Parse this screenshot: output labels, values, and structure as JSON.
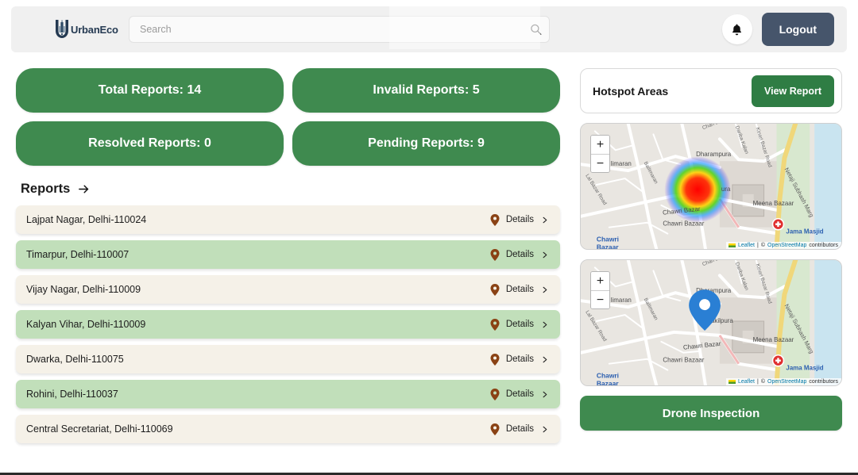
{
  "header": {
    "brand_name": "UrbanEco",
    "logo_icon": "u-building-logo-icon",
    "search": {
      "placeholder": "Search",
      "value": "",
      "icon": "search-icon"
    },
    "notification_icon": "bell-icon",
    "logout_label": "Logout"
  },
  "stats": [
    {
      "label": "Total Reports: 14",
      "name": "total-reports"
    },
    {
      "label": "Invalid Reports: 5",
      "name": "invalid-reports"
    },
    {
      "label": "Resolved Reports: 0",
      "name": "resolved-reports"
    },
    {
      "label": "Pending Reports: 9",
      "name": "pending-reports"
    }
  ],
  "reports_section": {
    "title": "Reports",
    "arrow_icon": "arrow-right-icon",
    "details_label": "Details",
    "pin_icon": "map-pin-icon",
    "chevron_icon": "chevron-right-icon",
    "rows": [
      {
        "location": "Lajpat Nagar, Delhi-110024",
        "tone": "cream"
      },
      {
        "location": "Timarpur, Delhi-110007",
        "tone": "green"
      },
      {
        "location": "Vijay Nagar, Delhi-110009",
        "tone": "cream"
      },
      {
        "location": "Kalyan Vihar, Delhi-110009",
        "tone": "green"
      },
      {
        "location": "Dwarka, Delhi-110075",
        "tone": "cream"
      },
      {
        "location": "Rohini, Delhi-110037",
        "tone": "green"
      },
      {
        "location": "Central Secretariat, Delhi-110069",
        "tone": "cream"
      }
    ]
  },
  "hotspot": {
    "title": "Hotspot Areas",
    "view_report_label": "View Report"
  },
  "maps": [
    {
      "name": "heatmap-map",
      "zoom_in_label": "+",
      "zoom_out_label": "−",
      "marker_type": "heatmap",
      "attribution": {
        "leaflet_label": "Leaflet",
        "separator": " | ",
        "osm_prefix": "© ",
        "osm_label": "OpenStreetMap",
        "osm_suffix": " contributors"
      },
      "labels": [
        "Dharampura",
        "Meena Bazaar",
        "Chawri Bazar",
        "Chawri Bazaar",
        "Jama Masjid",
        "Netaji Subhash Marg",
        "Ballimaran",
        "Lal Bazar Road",
        "limaran",
        "Chawri",
        "Bazaar",
        "ura"
      ]
    },
    {
      "name": "marker-map",
      "zoom_in_label": "+",
      "zoom_out_label": "−",
      "marker_type": "pin",
      "attribution": {
        "leaflet_label": "Leaflet",
        "separator": " | ",
        "osm_prefix": "© ",
        "osm_label": "OpenStreetMap",
        "osm_suffix": " contributors"
      },
      "labels": [
        "Dharampura",
        "Meena Bazaar",
        "Chawri Bazar",
        "Chawri Bazaar",
        "Jama Masjid",
        "Netaji Subhash Marg",
        "Ballimaran",
        "Lal Bazar Road",
        "limaran",
        "Chawri",
        "Bazaar",
        "akilpura"
      ]
    }
  ],
  "drone_button_label": "Drone Inspection",
  "colors": {
    "brand_green": "#3f8a4f",
    "dark_green": "#2f7d44",
    "row_cream": "#f5f1e8",
    "row_green": "#c1dfba",
    "logout_slate": "#46556b",
    "pin_brown": "#8a4214",
    "marker_blue": "#2a7fd4",
    "header_grey": "#f0f0f0"
  }
}
